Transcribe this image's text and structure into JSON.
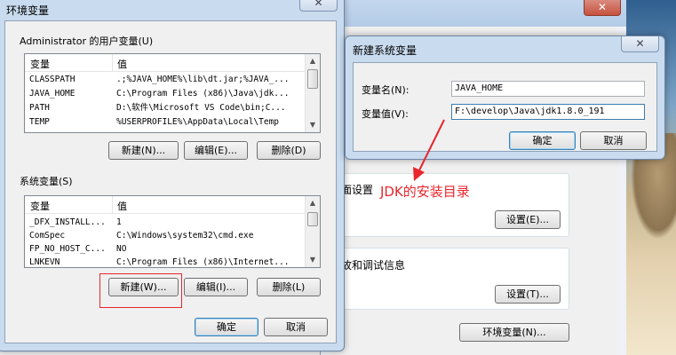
{
  "env_dialog": {
    "title": "环境变量",
    "user_vars": {
      "label": "Administrator 的用户变量(U)",
      "col_var": "变量",
      "col_val": "值",
      "rows": [
        {
          "name": "CLASSPATH",
          "value": ".;%JAVA_HOME%\\lib\\dt.jar;%JAVA_..."
        },
        {
          "name": "JAVA_HOME",
          "value": "C:\\Program Files (x86)\\Java\\jdk..."
        },
        {
          "name": "PATH",
          "value": "D:\\软件\\Microsoft VS Code\\bin;C..."
        },
        {
          "name": "TEMP",
          "value": "%USERPROFILE%\\AppData\\Local\\Temp"
        }
      ],
      "new_btn": "新建(N)...",
      "edit_btn": "编辑(E)...",
      "delete_btn": "删除(D)"
    },
    "sys_vars": {
      "label": "系统变量(S)",
      "col_var": "变量",
      "col_val": "值",
      "rows": [
        {
          "name": "_DFX_INSTALL...",
          "value": "1"
        },
        {
          "name": "ComSpec",
          "value": "C:\\Windows\\system32\\cmd.exe"
        },
        {
          "name": "FP_NO_HOST_C...",
          "value": "NO"
        },
        {
          "name": "LNKEVN",
          "value": "C:\\Program Files (x86)\\Internet..."
        }
      ],
      "new_btn": "新建(W)...",
      "edit_btn": "编辑(I)...",
      "delete_btn": "删除(L)"
    },
    "ok_btn": "确定",
    "cancel_btn": "取消"
  },
  "new_var_dialog": {
    "title": "新建系统变量",
    "name_label": "变量名(N):",
    "value_label": "变量值(V):",
    "name_value": "JAVA_HOME",
    "value_value": "F:\\develop\\Java\\jdk1.8.0_191",
    "ok_btn": "确定",
    "cancel_btn": "取消"
  },
  "back_window": {
    "text1": "面设置",
    "settings_btn1": "设置(E)...",
    "text2": "故和调试信息",
    "settings_btn2": "设置(T)...",
    "env_vars_btn": "环境变量(N)..."
  },
  "annotation": {
    "text": "JDK的安装目录",
    "color": "#e8262d"
  }
}
